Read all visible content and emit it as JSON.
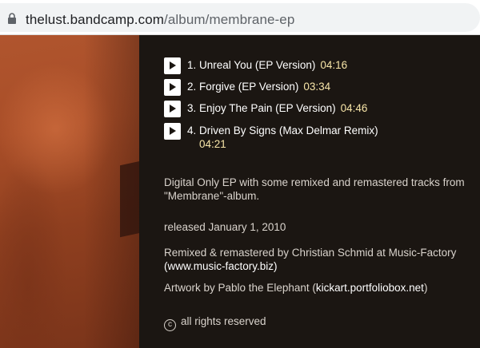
{
  "browser": {
    "url_host": "thelust.bandcamp.com",
    "url_path": "/album/membrane-ep",
    "lock_icon": "lock-icon"
  },
  "tracks": [
    {
      "number": "1.",
      "title": "Unreal You (EP Version)",
      "duration": "04:16"
    },
    {
      "number": "2.",
      "title": "Forgive (EP Version)",
      "duration": "03:34"
    },
    {
      "number": "3.",
      "title": "Enjoy The Pain (EP Version)",
      "duration": "04:46"
    },
    {
      "number": "4.",
      "title": "Driven By Signs (Max Delmar Remix)",
      "duration": "04:21"
    }
  ],
  "about": {
    "description_line1": "Digital Only EP with some remixed and remastered tracks from",
    "description_line2": "\"Membrane\"-album.",
    "released": "released January 1, 2010",
    "credits_line1": "Remixed & remastered by Christian Schmid at Music-Factory",
    "credits_link": "(www.music-factory.biz)",
    "artwork_prefix": "Artwork by Pablo the Elephant (",
    "artwork_link": "kickart.portfoliobox.net",
    "artwork_suffix": ")",
    "rights": "all rights reserved",
    "rights_icon": "c"
  },
  "colors": {
    "background": "#1b1612",
    "duration": "#f7e5a8",
    "text": "#d9d3cc"
  }
}
